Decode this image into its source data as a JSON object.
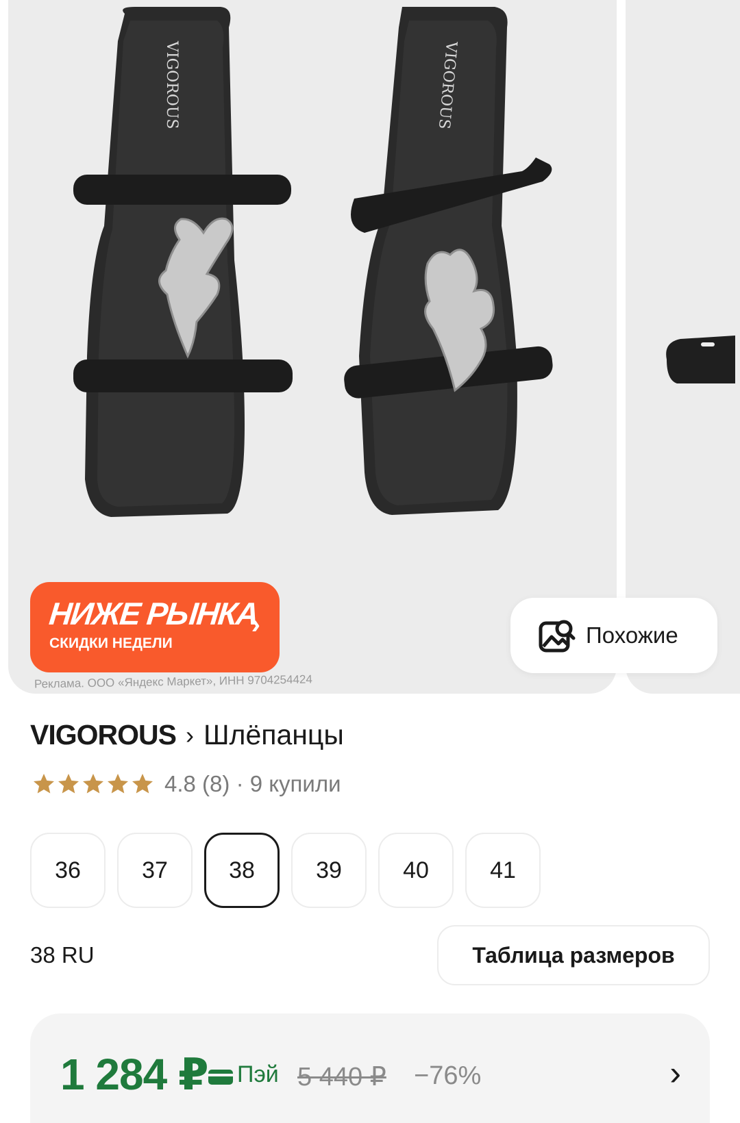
{
  "gallery": {
    "logo_text": "VIGOROUS",
    "promo": {
      "title": "НИЖЕ РЫНКА",
      "subtitle": "СКИДКИ НЕДЕЛИ"
    },
    "ad_note": "Реклама. ООО «Яндекс Маркет», ИНН 9704254424",
    "similar_label": "Похожие"
  },
  "product": {
    "brand": "VIGOROUS",
    "separator": "›",
    "category": "Шлёпанцы",
    "rating": "4.8",
    "reviews": "(8)",
    "bought": "· 9 купили",
    "stars": 5
  },
  "sizes": {
    "options": [
      "36",
      "37",
      "38",
      "39",
      "40",
      "41"
    ],
    "selected": "38",
    "selected_label": "38 RU",
    "size_table_label": "Таблица размеров"
  },
  "price": {
    "current": "1 284 ₽",
    "pay_label": "Пэй",
    "old": "5 440 ₽",
    "discount": "−76%"
  },
  "colors": {
    "accent_green": "#1f7a3c",
    "promo_orange": "#f95a2c",
    "star": "#c8954a"
  }
}
